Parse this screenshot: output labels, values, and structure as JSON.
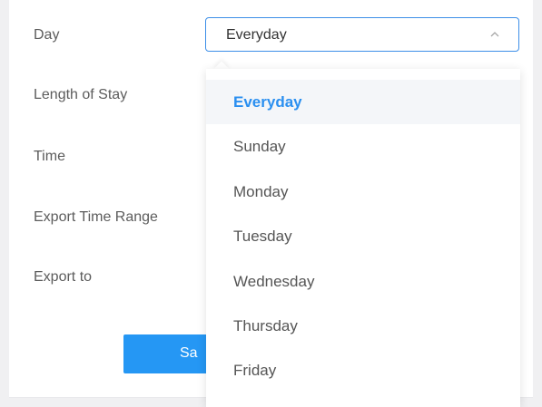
{
  "form": {
    "labels": {
      "day": "Day",
      "length_of_stay": "Length of Stay",
      "time": "Time",
      "export_time_range": "Export Time Range",
      "export_to": "Export to"
    },
    "day_select": {
      "value": "Everyday",
      "icon": "chevron-up-icon",
      "border_color": "#3d8fe8"
    },
    "save_button": {
      "label": "Sa",
      "color": "#2597f4"
    }
  },
  "dropdown": {
    "selected_color": "#2a8ff0",
    "options": [
      {
        "label": "Everyday",
        "selected": true
      },
      {
        "label": "Sunday",
        "selected": false
      },
      {
        "label": "Monday",
        "selected": false
      },
      {
        "label": "Tuesday",
        "selected": false
      },
      {
        "label": "Wednesday",
        "selected": false
      },
      {
        "label": "Thursday",
        "selected": false
      },
      {
        "label": "Friday",
        "selected": false
      }
    ]
  }
}
